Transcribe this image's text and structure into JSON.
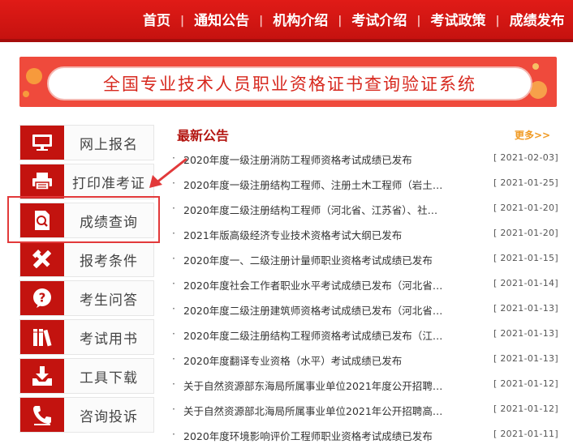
{
  "nav": {
    "items": [
      "首页",
      "通知公告",
      "机构介绍",
      "考试介绍",
      "考试政策",
      "成绩发布"
    ],
    "separator": "|"
  },
  "banner": {
    "title": "全国专业技术人员职业资格证书查询验证系统"
  },
  "sidebar": {
    "items": [
      {
        "label": "网上报名",
        "icon": "monitor-icon"
      },
      {
        "label": "打印准考证",
        "icon": "printer-icon"
      },
      {
        "label": "成绩查询",
        "icon": "search-document-icon"
      },
      {
        "label": "报考条件",
        "icon": "tools-icon"
      },
      {
        "label": "考生问答",
        "icon": "question-bubble-icon"
      },
      {
        "label": "考试用书",
        "icon": "books-icon"
      },
      {
        "label": "工具下载",
        "icon": "download-tray-icon"
      },
      {
        "label": "咨询投诉",
        "icon": "phone-icon"
      }
    ],
    "highlighted_index": 2
  },
  "notices": {
    "heading": "最新公告",
    "more_label": "更多>>",
    "bullet": "·",
    "items": [
      {
        "title": "2020年度一级注册消防工程师资格考试成绩已发布",
        "date": "[ 2021-02-03]"
      },
      {
        "title": "2020年度一级注册结构工程师、注册土木工程师（岩土…",
        "date": "[ 2021-01-25]"
      },
      {
        "title": "2020年度二级注册结构工程师（河北省、江苏省）、社…",
        "date": "[ 2021-01-20]"
      },
      {
        "title": "2021年版高级经济专业技术资格考试大纲已发布",
        "date": "[ 2021-01-20]"
      },
      {
        "title": "2020年度一、二级注册计量师职业资格考试成绩已发布",
        "date": "[ 2021-01-15]"
      },
      {
        "title": "2020年度社会工作者职业水平考试成绩已发布（河北省…",
        "date": "[ 2021-01-14]"
      },
      {
        "title": "2020年度二级注册建筑师资格考试成绩已发布（河北省…",
        "date": "[ 2021-01-13]"
      },
      {
        "title": "2020年度二级注册结构工程师资格考试成绩已发布（江…",
        "date": "[ 2021-01-13]"
      },
      {
        "title": "2020年度翻译专业资格（水平）考试成绩已发布",
        "date": "[ 2021-01-13]"
      },
      {
        "title": "关于自然资源部东海局所属事业单位2021年度公开招聘…",
        "date": "[ 2021-01-12]"
      },
      {
        "title": "关于自然资源部北海局所属事业单位2021年公开招聘高…",
        "date": "[ 2021-01-12]"
      },
      {
        "title": "2020年度环境影响评价工程师职业资格考试成绩已发布",
        "date": "[ 2021-01-11]"
      }
    ]
  },
  "colors": {
    "brand_red": "#c3130f",
    "banner_red": "#ef4a3c",
    "heading_red": "#b31510",
    "more_orange": "#f09a23",
    "highlight_border": "#e2393a"
  }
}
